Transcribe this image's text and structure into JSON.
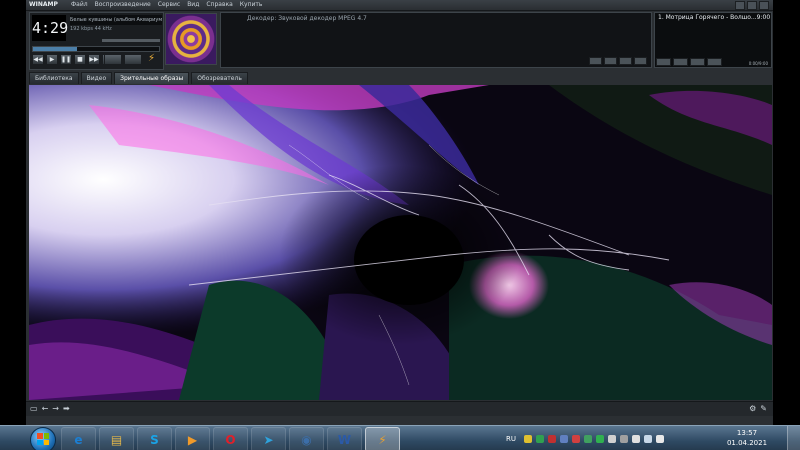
{
  "app": {
    "name": "WINAMP",
    "menu": [
      "Файл",
      "Воспроизведение",
      "Сервис",
      "Вид",
      "Справка",
      "Купить"
    ]
  },
  "player": {
    "time": "4:29",
    "song_title": "Белые кувшины (альбом Аквариум и ...",
    "bitrate": "192 kbps  44 kHz",
    "seek_progress": 0.35,
    "volume_level": 0.65
  },
  "info_panel": {
    "decoder_text": "Декодер: Звуковой декодер MPEG 4.7"
  },
  "playlist": {
    "items": [
      {
        "title": "1. Мотрица Горячего - Волшо...",
        "duration": "9:00"
      }
    ],
    "time_display": "0:00/9:00"
  },
  "tabs": [
    {
      "label": "Библиотека",
      "active": false
    },
    {
      "label": "Видео",
      "active": false
    },
    {
      "label": "Зрительные образы",
      "active": true
    },
    {
      "label": "Обозреватель",
      "active": false
    }
  ],
  "taskbar": {
    "language": "RU",
    "clock_time": "13:57",
    "clock_date": "01.04.2021",
    "apps": [
      {
        "name": "internet-explorer",
        "glyph": "e",
        "color": "#1b7fd4"
      },
      {
        "name": "file-explorer",
        "glyph": "▤",
        "color": "#e5b84a"
      },
      {
        "name": "skype",
        "glyph": "S",
        "color": "#1aa3e6"
      },
      {
        "name": "media-player",
        "glyph": "▶",
        "color": "#f09a2a"
      },
      {
        "name": "opera",
        "glyph": "O",
        "color": "#e0202a"
      },
      {
        "name": "telegram",
        "glyph": "➤",
        "color": "#2ea3dd"
      },
      {
        "name": "vpn-app",
        "glyph": "◉",
        "color": "#3c6ea8"
      },
      {
        "name": "word",
        "glyph": "W",
        "color": "#2b5aa8"
      },
      {
        "name": "winamp",
        "glyph": "⚡",
        "color": "#e8a030"
      }
    ]
  },
  "colors": {
    "accent": "#4c7fa8",
    "window_bg": "#2b2f33",
    "taskbar_top": "#5a7690"
  }
}
